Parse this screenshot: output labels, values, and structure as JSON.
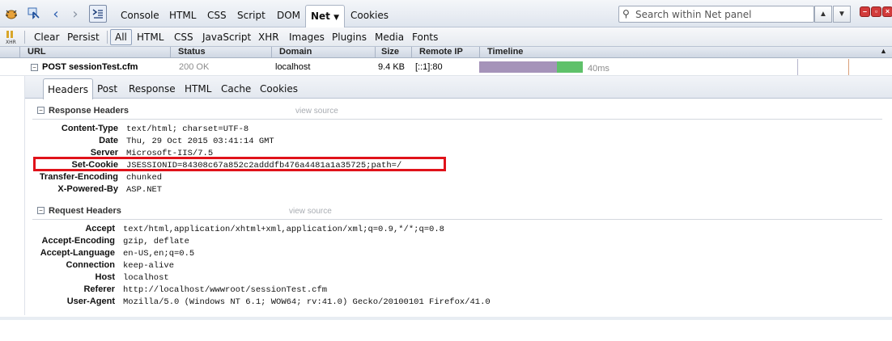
{
  "toolbar": {
    "tabs": [
      "Console",
      "HTML",
      "CSS",
      "Script",
      "DOM",
      "Net",
      "Cookies"
    ],
    "active_tab": "Net",
    "search_placeholder": "Search within Net panel"
  },
  "filter_bar": {
    "clear_label": "Clear",
    "persist_label": "Persist",
    "filters": [
      "All",
      "HTML",
      "CSS",
      "JavaScript",
      "XHR",
      "Images",
      "Plugins",
      "Media",
      "Fonts"
    ],
    "active_filter": "All"
  },
  "columns": [
    "URL",
    "Status",
    "Domain",
    "Size",
    "Remote IP",
    "Timeline"
  ],
  "request": {
    "url": "POST sessionTest.cfm",
    "status": "200 OK",
    "domain": "localhost",
    "size": "9.4 KB",
    "remote_ip": "[::1]:80",
    "time": "40ms",
    "wait_color": "#a593b9",
    "receive_color": "#5fc16a"
  },
  "detail_tabs": [
    "Headers",
    "Post",
    "Response",
    "HTML",
    "Cache",
    "Cookies"
  ],
  "active_detail_tab": "Headers",
  "response_headers": {
    "title": "Response Headers",
    "view_source": "view source",
    "items": [
      {
        "name": "Content-Type",
        "value": "text/html; charset=UTF-8"
      },
      {
        "name": "Date",
        "value": "Thu, 29 Oct 2015 03:41:14 GMT"
      },
      {
        "name": "Server",
        "value": "Microsoft-IIS/7.5"
      },
      {
        "name": "Set-Cookie",
        "value": "JSESSIONID=84308c67a852c2adddfb476a4481a1a35725;path=/"
      },
      {
        "name": "Transfer-Encoding",
        "value": "chunked"
      },
      {
        "name": "X-Powered-By",
        "value": "ASP.NET"
      }
    ]
  },
  "request_headers": {
    "title": "Request Headers",
    "view_source": "view source",
    "items": [
      {
        "name": "Accept",
        "value": "text/html,application/xhtml+xml,application/xml;q=0.9,*/*;q=0.8"
      },
      {
        "name": "Accept-Encoding",
        "value": "gzip, deflate"
      },
      {
        "name": "Accept-Language",
        "value": "en-US,en;q=0.5"
      },
      {
        "name": "Connection",
        "value": "keep-alive"
      },
      {
        "name": "Host",
        "value": "localhost"
      },
      {
        "name": "Referer",
        "value": "http://localhost/wwwroot/sessionTest.cfm"
      },
      {
        "name": "User-Agent",
        "value": "Mozilla/5.0 (Windows NT 6.1; WOW64; rv:41.0) Gecko/20100101 Firefox/41.0"
      }
    ]
  },
  "highlight_color": "#e0121a"
}
